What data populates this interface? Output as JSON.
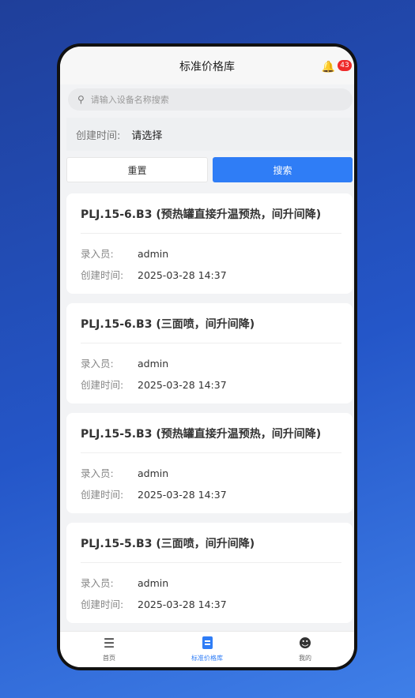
{
  "header": {
    "title": "标准价格库",
    "notification_count": "43"
  },
  "search": {
    "placeholder": "请输入设备名称搜索"
  },
  "filter": {
    "created_label": "创建时间:",
    "created_value": "请选择"
  },
  "buttons": {
    "reset": "重置",
    "search": "搜索"
  },
  "items": [
    {
      "name": "PLJ.15-6.B3 (预热罐直接升温预热，间升间降)",
      "entered_by_label": "录入员:",
      "entered_by": "admin",
      "created_label": "创建时间:",
      "created": "2025-03-28 14:37"
    },
    {
      "name": "PLJ.15-6.B3 (三面喷，间升间降)",
      "entered_by_label": "录入员:",
      "entered_by": "admin",
      "created_label": "创建时间:",
      "created": "2025-03-28 14:37"
    },
    {
      "name": "PLJ.15-5.B3 (预热罐直接升温预热，间升间降)",
      "entered_by_label": "录入员:",
      "entered_by": "admin",
      "created_label": "创建时间:",
      "created": "2025-03-28 14:37"
    },
    {
      "name": "PLJ.15-5.B3 (三面喷，间升间降)",
      "entered_by_label": "录入员:",
      "entered_by": "admin",
      "created_label": "创建时间:",
      "created": "2025-03-28 14:37"
    }
  ],
  "tabbar": {
    "home": "首页",
    "price_library": "标准价格库",
    "mine": "我的"
  },
  "colors": {
    "accent": "#2f7df6",
    "badge": "#ee2a2a"
  }
}
